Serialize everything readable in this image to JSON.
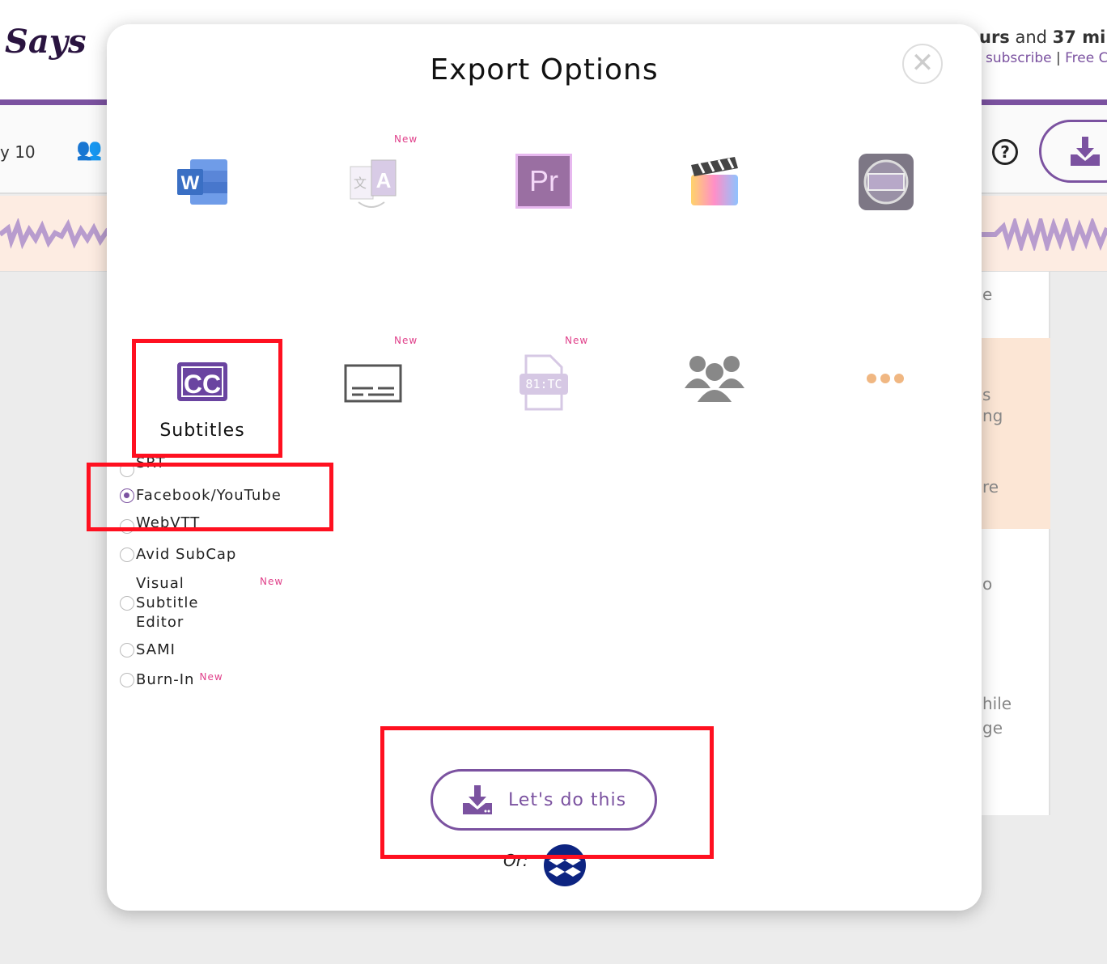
{
  "background": {
    "logo": "Says",
    "hours_prefix": "urs",
    "hours_mid": " and ",
    "hours_num": "37",
    "hours_suffix": " min",
    "subscribe_link": "subscribe",
    "link_sep": " | ",
    "free_link": "Free C",
    "date_fragment": "y 10",
    "right_fragments": [
      "e",
      "s",
      "ng",
      "re",
      "o",
      "hile",
      "ge"
    ]
  },
  "modal": {
    "title": "Export Options",
    "close_icon": "close-icon",
    "options_row1": [
      {
        "name": "word",
        "icon": "word-icon",
        "badge": ""
      },
      {
        "name": "translate",
        "icon": "translate-icon",
        "badge": "New"
      },
      {
        "name": "premiere",
        "icon": "premiere-icon",
        "icon_text": "Pr",
        "badge": ""
      },
      {
        "name": "final-cut",
        "icon": "final-cut-icon",
        "badge": ""
      },
      {
        "name": "avid",
        "icon": "avid-icon",
        "badge": ""
      }
    ],
    "options_row2": [
      {
        "name": "subtitles",
        "icon": "cc-icon",
        "icon_text": "CC",
        "label": "Subtitles",
        "badge": ""
      },
      {
        "name": "captions",
        "icon": "caption-icon",
        "badge": "New"
      },
      {
        "name": "timecode",
        "icon": "timecode-file-icon",
        "icon_text": "81:TC",
        "badge": "New"
      },
      {
        "name": "people",
        "icon": "people-icon",
        "badge": ""
      },
      {
        "name": "more",
        "icon": "more-icon",
        "badge": ""
      }
    ],
    "subtitle_formats": [
      {
        "label": "SRT",
        "selected": false
      },
      {
        "label": "Facebook/YouTube",
        "selected": true
      },
      {
        "label": "WebVTT",
        "selected": false
      },
      {
        "label": "Avid SubCap",
        "selected": false
      },
      {
        "label": "Visual Subtitle Editor",
        "line1": "Visual",
        "line2": "Subtitle",
        "line3": "Editor",
        "badge": "New",
        "selected": false
      },
      {
        "label": "SAMI",
        "selected": false
      },
      {
        "label": "Burn-In",
        "badge": "New",
        "selected": false
      }
    ],
    "submit_label": "Let's do this",
    "or_label": "Or:",
    "dropbox_icon": "dropbox-icon"
  },
  "colors": {
    "accent": "#7b52a0",
    "new_badge": "#e0408a",
    "highlight": "#ff1020",
    "peach": "#fce6d5"
  }
}
